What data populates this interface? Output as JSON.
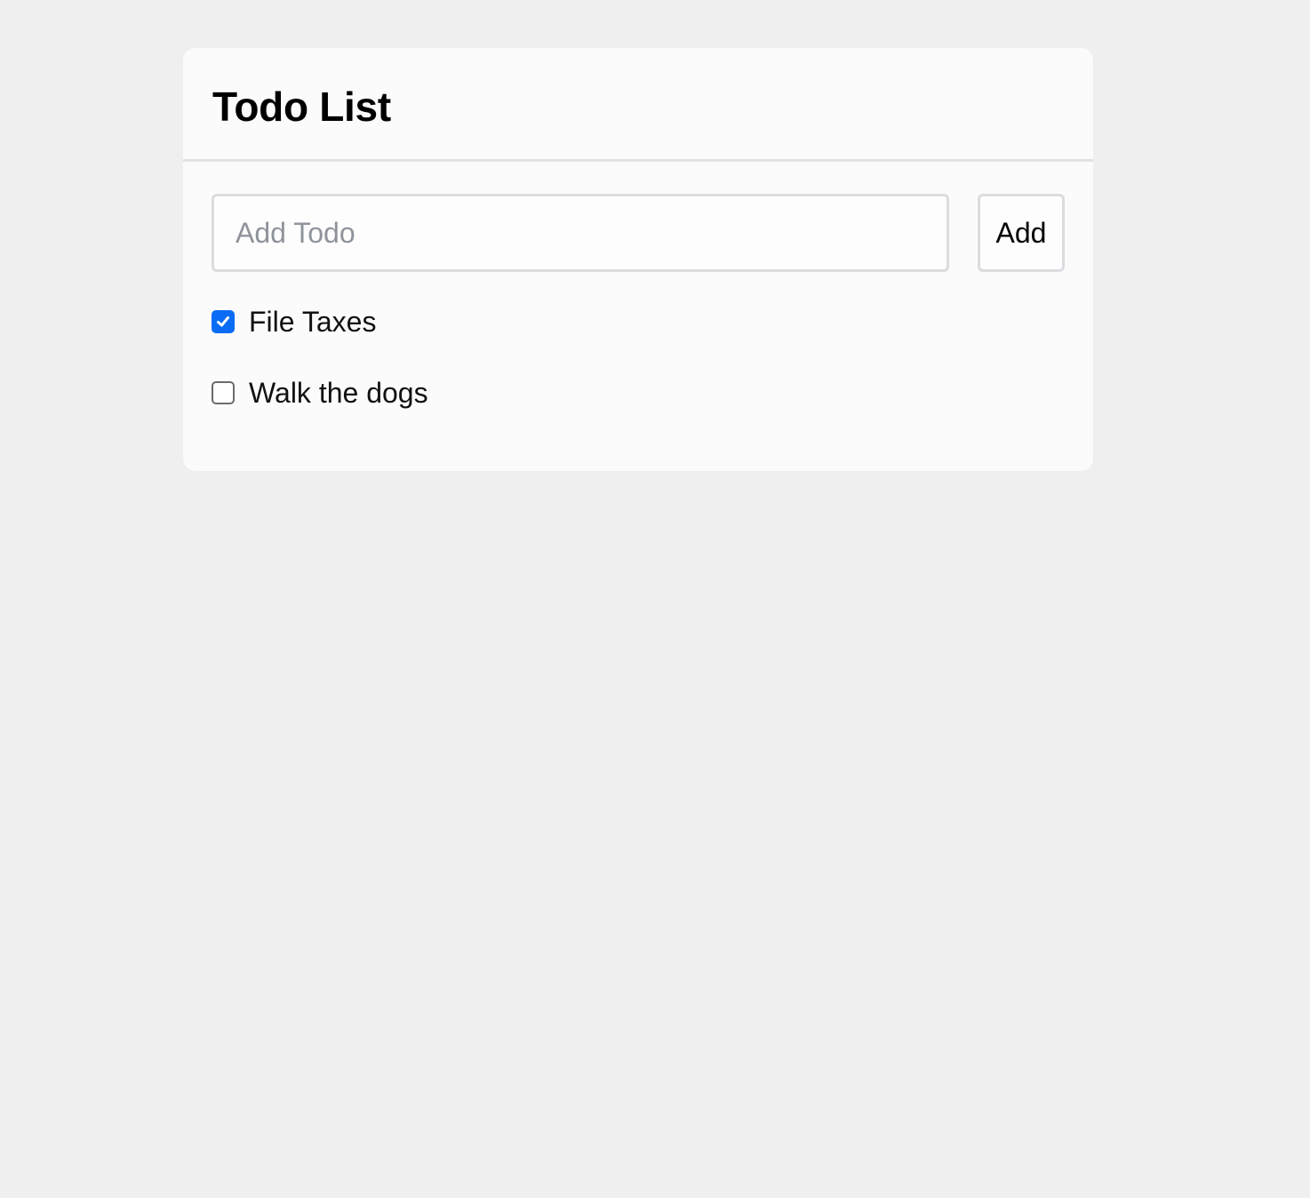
{
  "card": {
    "title": "Todo List"
  },
  "add_form": {
    "input_placeholder": "Add Todo",
    "input_value": "",
    "add_label": "Add"
  },
  "todos": [
    {
      "label": "File Taxes",
      "checked": true
    },
    {
      "label": "Walk the dogs",
      "checked": false
    }
  ],
  "colors": {
    "checkbox_checked": "#0a6cf5",
    "background": "#efefef",
    "card": "#fbfbfb"
  },
  "icons": {
    "checkmark": "checkmark-icon"
  }
}
